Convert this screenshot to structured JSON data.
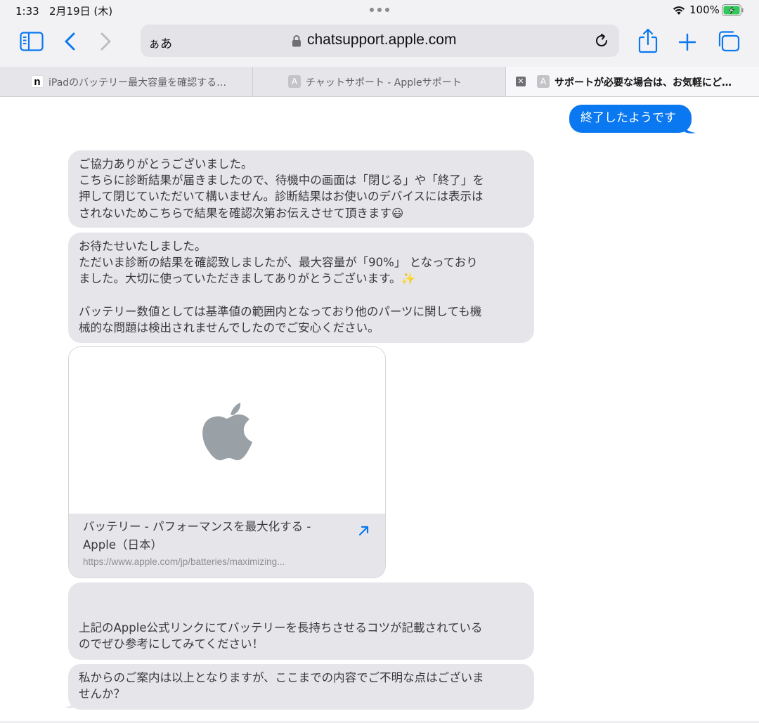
{
  "status_bar": {
    "time": "1:33",
    "date": "2月19日 (木)",
    "battery": "100%"
  },
  "toolbar": {
    "reader_label": "ぁあ",
    "url": "chatsupport.apple.com"
  },
  "tabs": [
    {
      "icon": "n",
      "title": "iPadのバッテリー最大容量を確認する…"
    },
    {
      "icon": "A",
      "title": "チャットサポート - Appleサポート"
    },
    {
      "icon": "A",
      "title": "サポートが必要な場合は、お気軽にど…",
      "close": "✕"
    }
  ],
  "chat": {
    "outgoing": "終了したようです",
    "messages": [
      "ご協力ありがとうございました。\nこちらに診断結果が届きましたので、待機中の画面は「閉じる」や「終了」を\n押して閉じていただいて構いません。診断結果はお使いのデバイスには表示は\nされないためこちらで結果を確認次第お伝えさせて頂きます😃",
      "お待たせいたしました。\nただいま診断の結果を確認致しましたが、最大容量が「90%」 となっており\nました。大切に使っていただきましてありがとうございます。✨\n\nバッテリー数値としては基準値の範囲内となっており他のパーツに関しても機\n械的な問題は検出されませんでしたのでご安心ください。",
      "\n上記のApple公式リンクにてバッテリーを長持ちさせるコツが記載されている\nのでぜひ参考にしてみてください！",
      "私からのご案内は以上となりますが、ここまでの内容でご不明な点はございま\nせんか？"
    ],
    "link_card": {
      "title": "バッテリー - パフォーマンスを最大化する -\nApple（日本）",
      "url": "https://www.apple.com/jp/batteries/maximizing..."
    }
  },
  "colors": {
    "accent": "#0a78f0",
    "incoming_bubble": "#e5e5ea",
    "battery_green": "#34c759"
  },
  "icons": [
    "sidebar-icon",
    "back-icon",
    "forward-icon",
    "lock-icon",
    "reload-icon",
    "share-icon",
    "new-tab-icon",
    "tab-overview-icon",
    "wifi-icon",
    "battery-icon",
    "apple-logo",
    "open-link-icon"
  ]
}
